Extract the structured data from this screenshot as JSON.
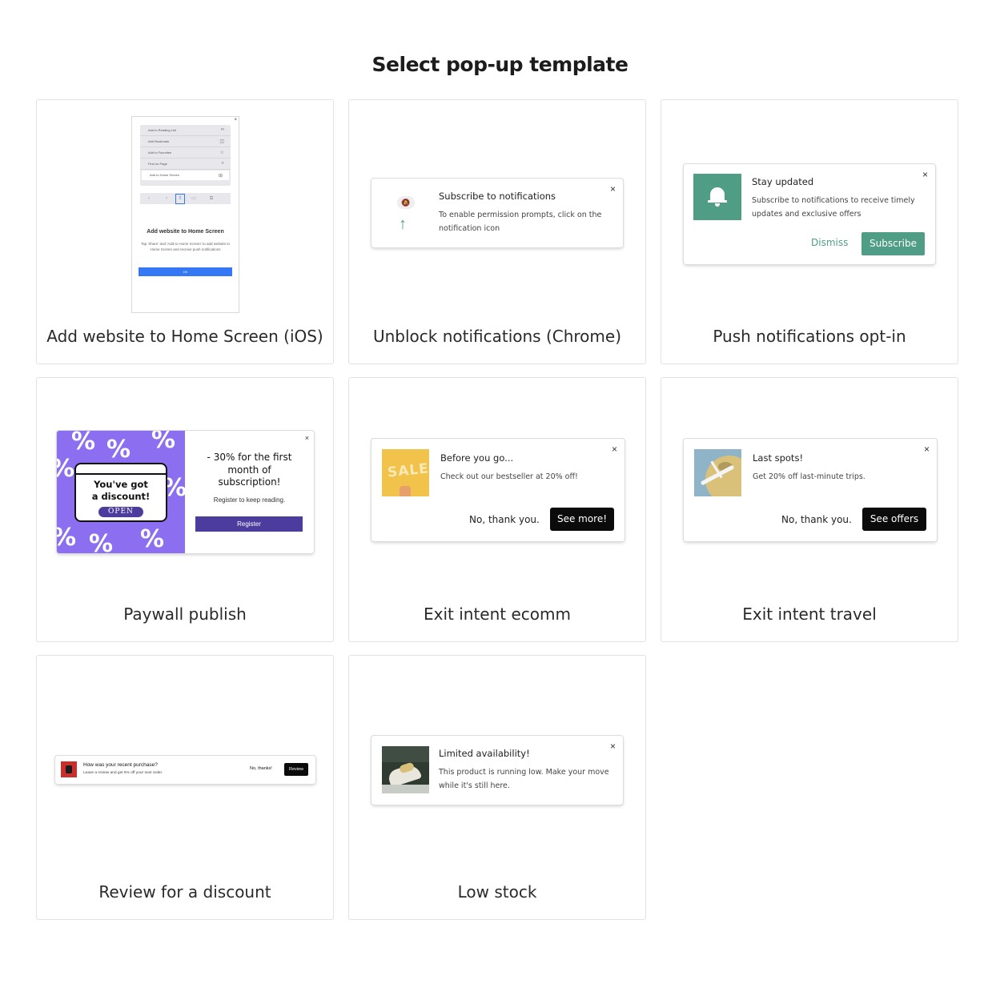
{
  "page": {
    "title": "Select pop-up template"
  },
  "colors": {
    "green": "#4f9d84",
    "purple": "#8c6ff0",
    "dark_purple": "#4b3c9e",
    "ios_blue": "#3478f6"
  },
  "templates": [
    {
      "label": "Add website to Home Screen (iOS)",
      "preview": {
        "menu_items": [
          "Add to Reading List",
          "Add Bookmark",
          "Add to Favorites",
          "Find on Page",
          "Add to Home Screen"
        ],
        "menu_icons": [
          "glasses-icon",
          "book-icon",
          "star-icon",
          "search-icon",
          "plus-square-icon"
        ],
        "toolbar_icons": [
          "chevron-left-icon",
          "chevron-right-icon",
          "share-icon",
          "book-icon",
          "tabs-icon"
        ],
        "title": "Add website to Home Screen",
        "description": "Tap 'Share' and 'Add to Home Screen' to add website to Home Screen and receive push notifications",
        "button": "OK"
      }
    },
    {
      "label": "Unblock notifications (Chrome)",
      "preview": {
        "title": "Subscribe to notifications",
        "body": "To enable permission prompts, click on the notification icon",
        "icons": [
          "bell-off-icon",
          "arrow-up-icon"
        ]
      }
    },
    {
      "label": "Push notifications opt-in",
      "preview": {
        "title": "Stay updated",
        "body": "Subscribe to notifications to receive timely updates and exclusive offers",
        "dismiss": "Dismiss",
        "subscribe": "Subscribe",
        "icon": "bell-icon"
      }
    },
    {
      "label": "Paywall publish",
      "preview": {
        "discount_line1": "You've got",
        "discount_line2": "a discount!",
        "open": "OPEN",
        "headline_line1": "- 30% for the first",
        "headline_line2": "month of",
        "headline_line3": "subscription!",
        "subtext": "Register to keep reading.",
        "button": "Register"
      }
    },
    {
      "label": "Exit intent ecomm",
      "preview": {
        "image_text": "SALE",
        "title": "Before you go...",
        "body": "Check out our bestseller at 20% off!",
        "decline": "No, thank you.",
        "accept": "See more!"
      }
    },
    {
      "label": "Exit intent travel",
      "preview": {
        "title": "Last spots!",
        "body": "Get 20% off last-minute trips.",
        "decline": "No, thank you.",
        "accept": "See offers"
      }
    },
    {
      "label": "Review for a discount",
      "preview": {
        "title": "How was your recent purchase?",
        "body": "Leave a review and get 5% off your next order.",
        "decline": "No, thanks!",
        "accept": "Review"
      }
    },
    {
      "label": "Low stock",
      "preview": {
        "title": "Limited availability!",
        "body": "This product is running low. Make your move while it's still here."
      }
    }
  ],
  "close_symbol": "×"
}
